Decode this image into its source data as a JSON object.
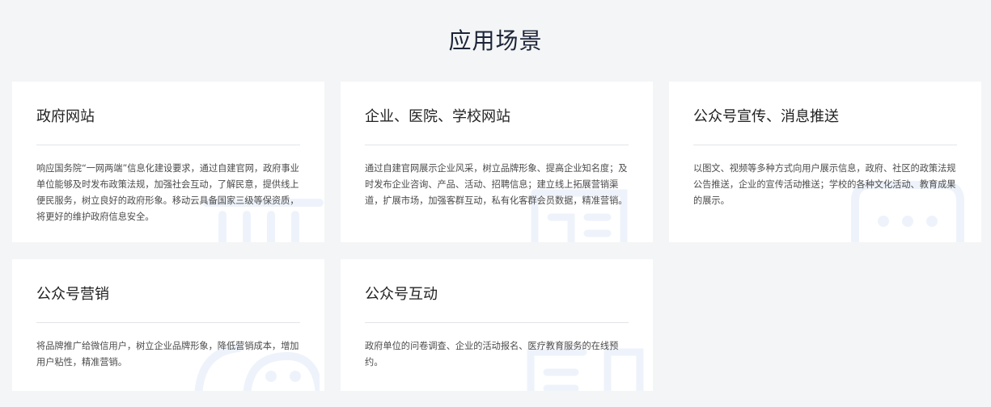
{
  "section": {
    "title": "应用场景"
  },
  "cards": [
    {
      "title": "政府网站",
      "desc": "响应国务院“一网两端”信息化建设要求，通过自建官网，政府事业单位能够及时发布政策法规，加强社会互动，了解民意，提供线上便民服务，树立良好的政府形象。移动云具备国家三级等保资质，将更好的维护政府信息安全。",
      "icon": "government-building-icon"
    },
    {
      "title": "企业、医院、学校网站",
      "desc": "通过自建官网展示企业风采，树立品牌形象、提高企业知名度；及时发布企业咨询、产品、活动、招聘信息；建立线上拓展营销渠道，扩展市场，加强客群互动，私有化客群会员数据，精准营销。",
      "icon": "website-browser-icon"
    },
    {
      "title": "公众号宣传、消息推送",
      "desc": "以图文、视频等多种方式向用户展示信息，政府、社区的政策法规公告推送，企业的宣传活动推送；学校的各种文化活动、教育成果的展示。",
      "icon": "message-bubble-icon"
    },
    {
      "title": "公众号营销",
      "desc": "将品牌推广给微信用户，树立企业品牌形象，降低营销成本，增加用户粘性，精准营销。",
      "icon": "wechat-icon"
    },
    {
      "title": "公众号互动",
      "desc": "政府单位的问卷调查、企业的活动报名、医疗教育服务的在线预约。",
      "icon": "form-survey-icon"
    }
  ]
}
